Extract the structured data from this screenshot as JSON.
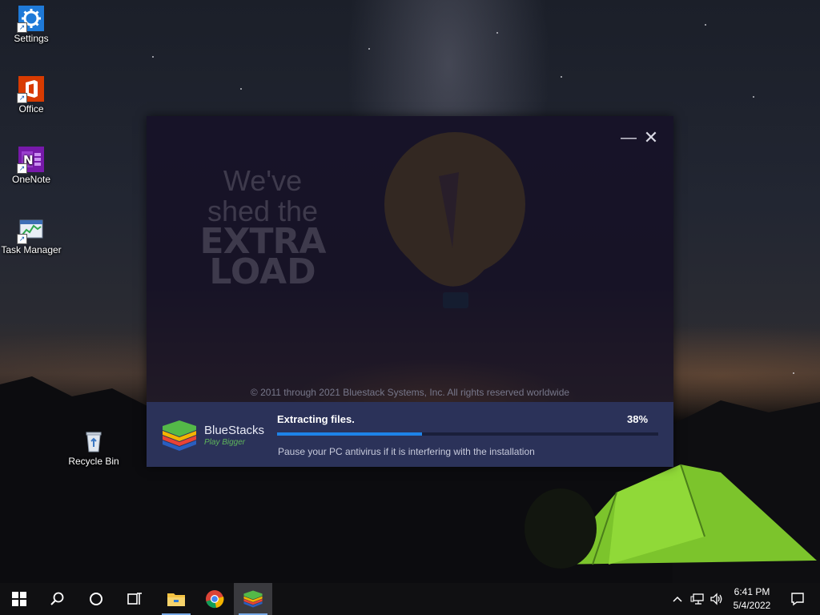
{
  "desktop": {
    "icons": [
      {
        "label": "Settings",
        "icon": "gear-icon"
      },
      {
        "label": "Office",
        "icon": "office-icon"
      },
      {
        "label": "OneNote",
        "icon": "onenote-icon"
      },
      {
        "label": "Task Manager",
        "icon": "task-manager-icon"
      },
      {
        "label": "Recycle Bin",
        "icon": "recycle-bin-icon"
      }
    ]
  },
  "installer": {
    "headline": {
      "line1": "We've",
      "line2": "shed the",
      "line3": "EXTRA",
      "line4": "LOAD"
    },
    "copyright": "© 2011 through 2021 Bluestack Systems, Inc. All rights reserved worldwide",
    "brand": {
      "name": "BlueStacks",
      "tagline": "Play Bigger"
    },
    "status": {
      "title": "Extracting files.",
      "percent_label": "38%",
      "progress": 0.38,
      "hint": "Pause your PC antivirus if it is interfering with the installation"
    },
    "window_controls": {
      "minimize": "—",
      "close": "✕"
    },
    "colors": {
      "bottom_bar": "#2b3259",
      "progress_fill": "#1e83e8",
      "tagline": "#5fb65a"
    }
  },
  "taskbar": {
    "buttons": [
      "start-icon",
      "search-icon",
      "cortana-icon",
      "task-view-icon"
    ],
    "pinned_apps": [
      "file-explorer-icon",
      "chrome-icon",
      "bluestacks-icon"
    ],
    "active_app": "bluestacks-icon",
    "tray": {
      "time": "6:41 PM",
      "date": "5/4/2022"
    }
  }
}
